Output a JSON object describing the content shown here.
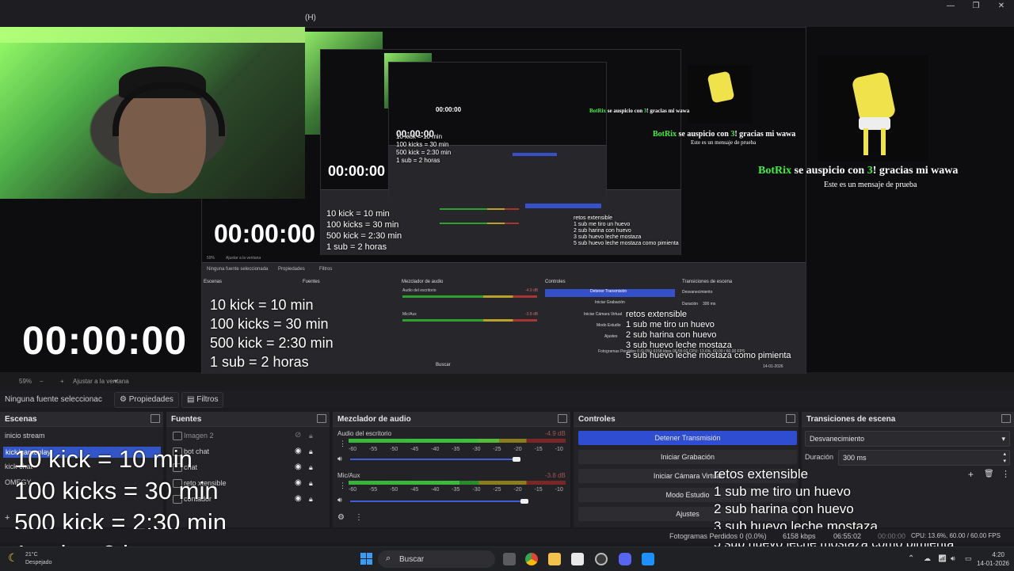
{
  "window": {
    "menu_hint": "(H)",
    "minimize": "—",
    "restore": "❐",
    "close": "✕"
  },
  "preview": {
    "timer": "00:00:00",
    "botrix": {
      "brand": "BotRix",
      "text_a": "se auspicio con",
      "num": "3",
      "text_b": "! gracias mi wawa",
      "sub": "Este es un mensaje de prueba"
    },
    "goals": [
      "10 kick = 10 min",
      "100 kicks = 30 min",
      "500 kick = 2:30 min",
      "1 sub = 2 horas"
    ],
    "retos": [
      "retos extensible",
      "1 sub me tiro un huevo",
      "2 sub harina con huevo",
      "3 sub huevo leche mostaza",
      "5 sub huevo leche mostaza como pimienta"
    ],
    "nested_nosel": "Ninguna fuente seleccionada",
    "nested_props": "Propiedades",
    "nested_filters": "Filtros",
    "nested_docks": [
      "Escenas",
      "Fuentes",
      "Mezclador de audio",
      "Controles",
      "Transiciones de escena"
    ],
    "nested_ctrl": [
      "Detener Transmisión",
      "Iniciar Grabación",
      "Iniciar Cámara Virtual",
      "Modo Estudio",
      "Ajustes"
    ],
    "nested_status": "Fotogramas Perdidos 0 (0.0%)   6158 kbps   06:55:02   CPU: 13.6%, 60.00 / 60.00 FPS",
    "nested_search": "Buscar",
    "nested_date": "14-01-2026",
    "nested_trans": "Desvanecimiento",
    "nested_dur_label": "Duración",
    "nested_dur": "300 ms",
    "nested_meter1": "Audio del escritorio",
    "nested_meter2": "Mic/Aux",
    "nested_db1": "-4.9 dB",
    "nested_db2": "-3.8 dB",
    "nested_zoom": "59%",
    "nested_fit": "Ajustar a la ventana"
  },
  "zoombar": {
    "zoom": "59%",
    "fit": "Ajustar a la ventana"
  },
  "source_toolbar": {
    "no_selection": "Ninguna fuente seleccionac",
    "properties": "Propiedades",
    "filters": "Filtros"
  },
  "scenes": {
    "title": "Escenas",
    "items": [
      "inicio stream",
      "kick/gameplay",
      "kick chat",
      "OMEGY"
    ]
  },
  "sources": {
    "title": "Fuentes",
    "items": [
      "Imagen 2",
      "bot chat",
      "chat",
      "reto xtensible",
      "contador"
    ]
  },
  "mixer": {
    "title": "Mezclador de audio",
    "channels": [
      {
        "name": "Audio del escritorio",
        "db": "-4.9 dB"
      },
      {
        "name": "Mic/Aux",
        "db": "-3.8 dB"
      }
    ],
    "scale": "-60 -55 -50 -45 -40 -35 -30 -25 -20 -15 -10 -5 0"
  },
  "controls": {
    "title": "Controles",
    "buttons": [
      "Detener Transmisión",
      "Iniciar Grabación",
      "Iniciar Cámara Virtual",
      "Modo Estudio",
      "Ajustes"
    ]
  },
  "transitions": {
    "title": "Transiciones de escena",
    "selected": "Desvanecimiento",
    "duration_label": "Duración",
    "duration": "300 ms"
  },
  "status": {
    "dropped": "Fotogramas Perdidos 0 (0.0%)",
    "kbps": "6158 kbps",
    "time": "06:55:02",
    "rec": "00:00:00",
    "cpu": "CPU: 13.6%, 60.00 / 60.00 FPS"
  },
  "taskbar": {
    "weather_temp": "21°C",
    "weather_desc": "Despejado",
    "search": "Buscar",
    "time": "4:20",
    "date": "14-01-2026"
  },
  "colors": {
    "accent": "#2f4dd1",
    "botrix_green": "#3cf03c"
  }
}
